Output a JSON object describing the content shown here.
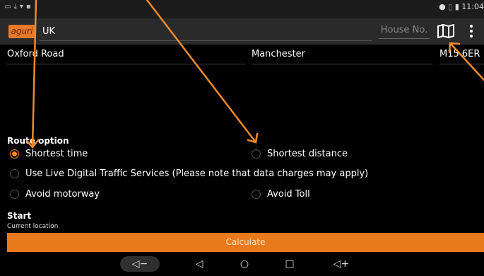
{
  "status_bar": {
    "left_icons": [
      "screenshot-icon",
      "download-icon",
      "wifi-icon",
      "lock-icon"
    ],
    "right_icons": [
      "location-icon",
      "vibrate-icon",
      "battery-icon"
    ],
    "time": "11:04"
  },
  "app_bar": {
    "logo_text": "aguri",
    "country": "UK",
    "house_placeholder": "House No."
  },
  "address": {
    "street": "Oxford Road",
    "city": "Manchester",
    "postcode": "M15 6ER"
  },
  "route": {
    "heading": "Route option",
    "options": [
      {
        "label": "Shortest time",
        "selected": true
      },
      {
        "label": "Shortest distance",
        "selected": false
      },
      {
        "label": "Use Live Digital Traffic Services (Please note that data charges may apply)",
        "selected": false
      },
      {
        "label": "Avoid motorway",
        "selected": false
      },
      {
        "label": "Avoid Toll",
        "selected": false
      }
    ]
  },
  "start": {
    "heading": "Start",
    "value": "Current location"
  },
  "calculate_label": "Calculate",
  "nav_bar": {
    "buttons": [
      "volume-down-icon",
      "back-icon",
      "home-icon",
      "recents-icon",
      "volume-up-icon"
    ]
  },
  "colors": {
    "accent": "#e87a1c",
    "annotation_arrow": "#f08a2c",
    "background": "#000000",
    "app_bar": "#2a2a2a"
  }
}
